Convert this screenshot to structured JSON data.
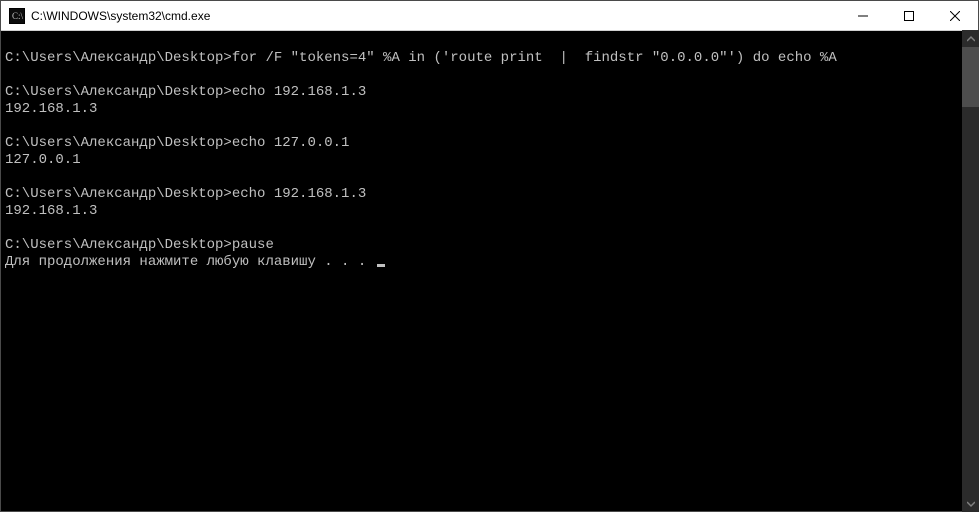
{
  "window": {
    "title": "C:\\WINDOWS\\system32\\cmd.exe"
  },
  "terminal": {
    "lines": [
      "",
      "C:\\Users\\Александр\\Desktop>for /F \"tokens=4\" %A in ('route print  |  findstr \"0.0.0.0\"') do echo %A",
      "",
      "C:\\Users\\Александр\\Desktop>echo 192.168.1.3",
      "192.168.1.3",
      "",
      "C:\\Users\\Александр\\Desktop>echo 127.0.0.1",
      "127.0.0.1",
      "",
      "C:\\Users\\Александр\\Desktop>echo 192.168.1.3",
      "192.168.1.3",
      "",
      "C:\\Users\\Александр\\Desktop>pause",
      "Для продолжения нажмите любую клавишу . . . "
    ]
  }
}
